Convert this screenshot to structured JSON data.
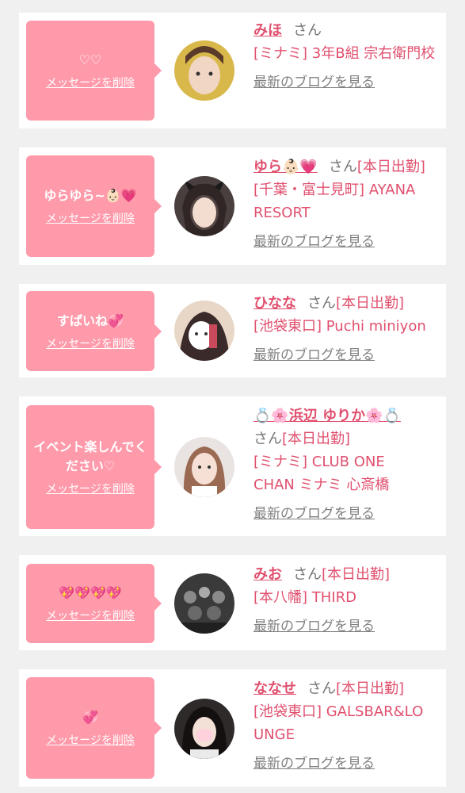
{
  "cards": [
    {
      "message": "♡♡",
      "delete_label": "メッセージを削除",
      "name": "みほ",
      "honorific": "さん",
      "status": "",
      "shop": "[ミナミ] 3年B組 宗右衛門校",
      "blog_link": "最新のブログを見る",
      "avatar_color": "#d8b84a"
    },
    {
      "message": "ゆらゆら~👶🏻💗",
      "delete_label": "メッセージを削除",
      "name": "ゆら👶🏻💗",
      "honorific": "さん",
      "status": "[本日出勤]",
      "shop": "[千葉・富士見町] AYANA RESORT",
      "blog_link": "最新のブログを見る",
      "avatar_color": "#4a3f3f"
    },
    {
      "message": "すぱいね💞",
      "delete_label": "メッセージを削除",
      "name": "ひなな",
      "honorific": "さん",
      "status": "[本日出勤]",
      "shop": "[池袋東口] Puchi miniyon",
      "blog_link": "最新のブログを見る",
      "avatar_color": "#e8d6c6"
    },
    {
      "message": "イベント楽しんでください♡",
      "delete_label": "メッセージを削除",
      "name": "💍🌸浜辺 ゆりか🌸💍",
      "honorific": "さん",
      "status": "[本日出勤]",
      "shop": "[ミナミ] CLUB ONE CHAN ミナミ 心斎橋",
      "blog_link": "最新のブログを見る",
      "avatar_color": "#c9a58c"
    },
    {
      "message": "💖💖💖💖",
      "delete_label": "メッセージを削除",
      "name": "みお",
      "honorific": "さん",
      "status": "[本日出勤]",
      "shop": "[本八幡] THIRD",
      "blog_link": "最新のブログを見る",
      "avatar_color": "#3a3a3a"
    },
    {
      "message": "💞",
      "delete_label": "メッセージを削除",
      "name": "ななせ",
      "honorific": "さん",
      "status": "[本日出勤]",
      "shop": "[池袋東口] GALSBAR&LOUNGE",
      "blog_link": "最新のブログを見る",
      "avatar_color": "#2e2a2a"
    }
  ],
  "colors": {
    "bubble": "#ff9aab",
    "accent": "#e0506e",
    "muted": "#777777"
  }
}
